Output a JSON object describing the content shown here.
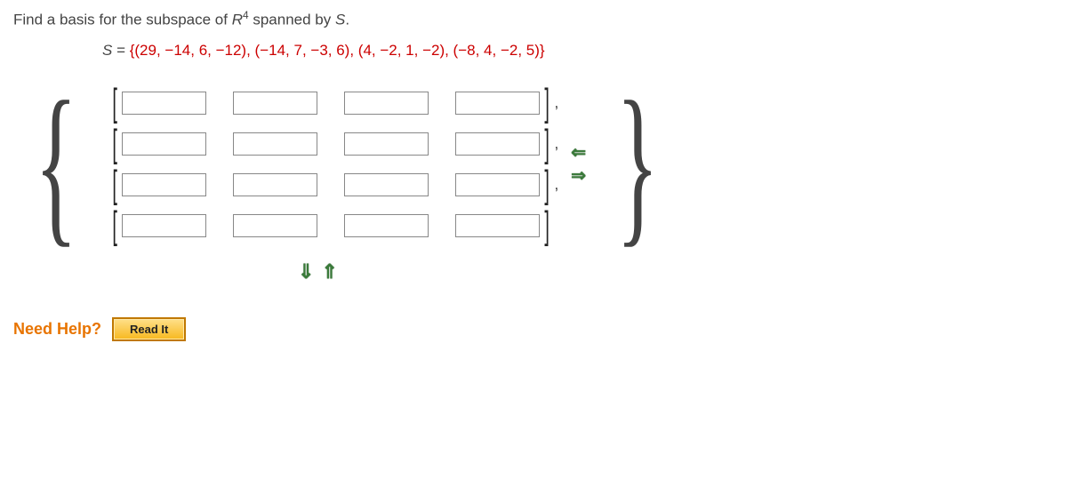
{
  "prompt": {
    "prefix": "Find a basis for the subspace of ",
    "space": "R",
    "exponent": "4",
    "middle": " spanned by ",
    "setvar": "S",
    "suffix": "."
  },
  "set_equation": {
    "lhs_var": "S",
    "equals": " = ",
    "rhs": "{(29, −14, 6, −12), (−14, 7, −3, 6), (4, −2, 1, −2), (−8, 4, −2, 5)}"
  },
  "matrix": {
    "rows": 4,
    "cols": 4,
    "values": [
      [
        "",
        "",
        "",
        ""
      ],
      [
        "",
        "",
        "",
        ""
      ],
      [
        "",
        "",
        "",
        ""
      ],
      [
        "",
        "",
        "",
        ""
      ]
    ]
  },
  "arrows": {
    "row_remove": "⇐",
    "row_add": "⇒",
    "col_remove": "⇓",
    "col_add": "⇑"
  },
  "help": {
    "label": "Need Help?",
    "read_it": "Read It"
  }
}
